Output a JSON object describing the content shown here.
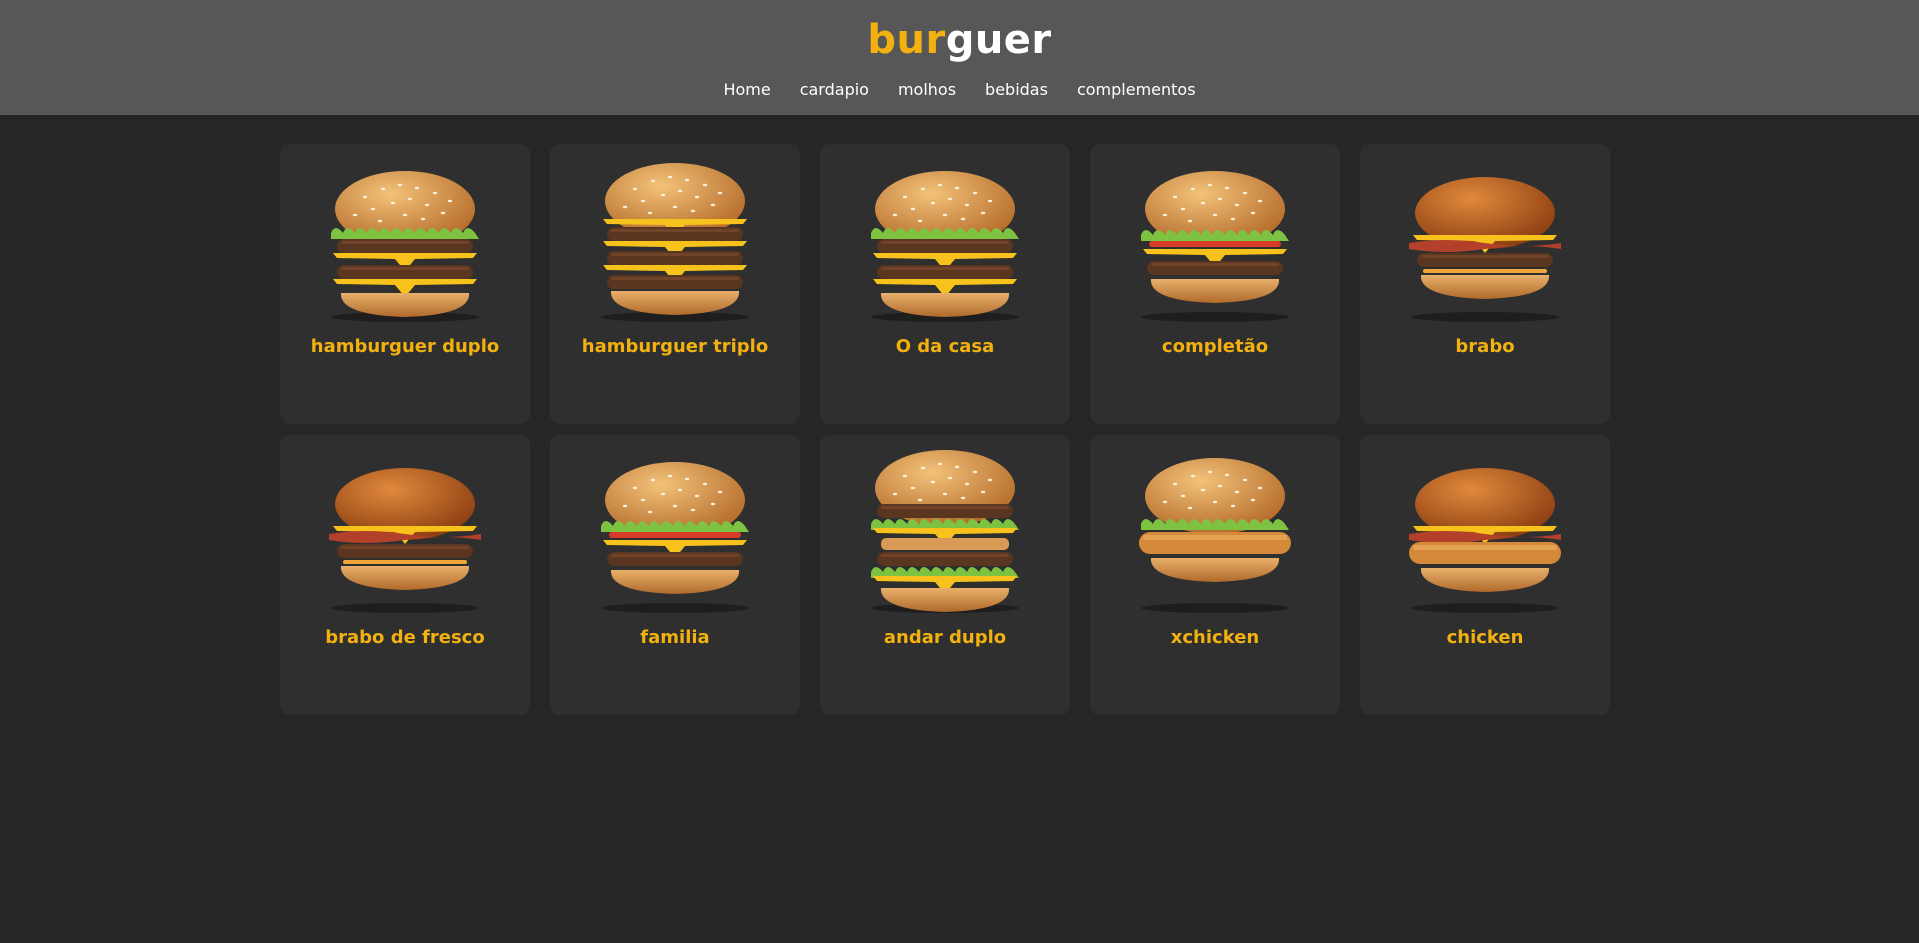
{
  "brand": {
    "part1": "bur",
    "part2": "guer",
    "accent": "#f2b10f"
  },
  "nav": [
    "Home",
    "cardapio",
    "molhos",
    "bebidas",
    "complementos"
  ],
  "products": [
    {
      "name": "hamburguer duplo",
      "style": "double-cheese"
    },
    {
      "name": "hamburguer triplo",
      "style": "triple-cheese"
    },
    {
      "name": "O da casa",
      "style": "double-cheese"
    },
    {
      "name": "completão",
      "style": "lettuce-tomato"
    },
    {
      "name": "brabo",
      "style": "brioche-bacon"
    },
    {
      "name": "brabo de fresco",
      "style": "brioche-bacon"
    },
    {
      "name": "familia",
      "style": "lettuce-tomato"
    },
    {
      "name": "andar duplo",
      "style": "big-double"
    },
    {
      "name": "xchicken",
      "style": "crispy-chicken"
    },
    {
      "name": "chicken",
      "style": "chicken-bacon"
    }
  ]
}
